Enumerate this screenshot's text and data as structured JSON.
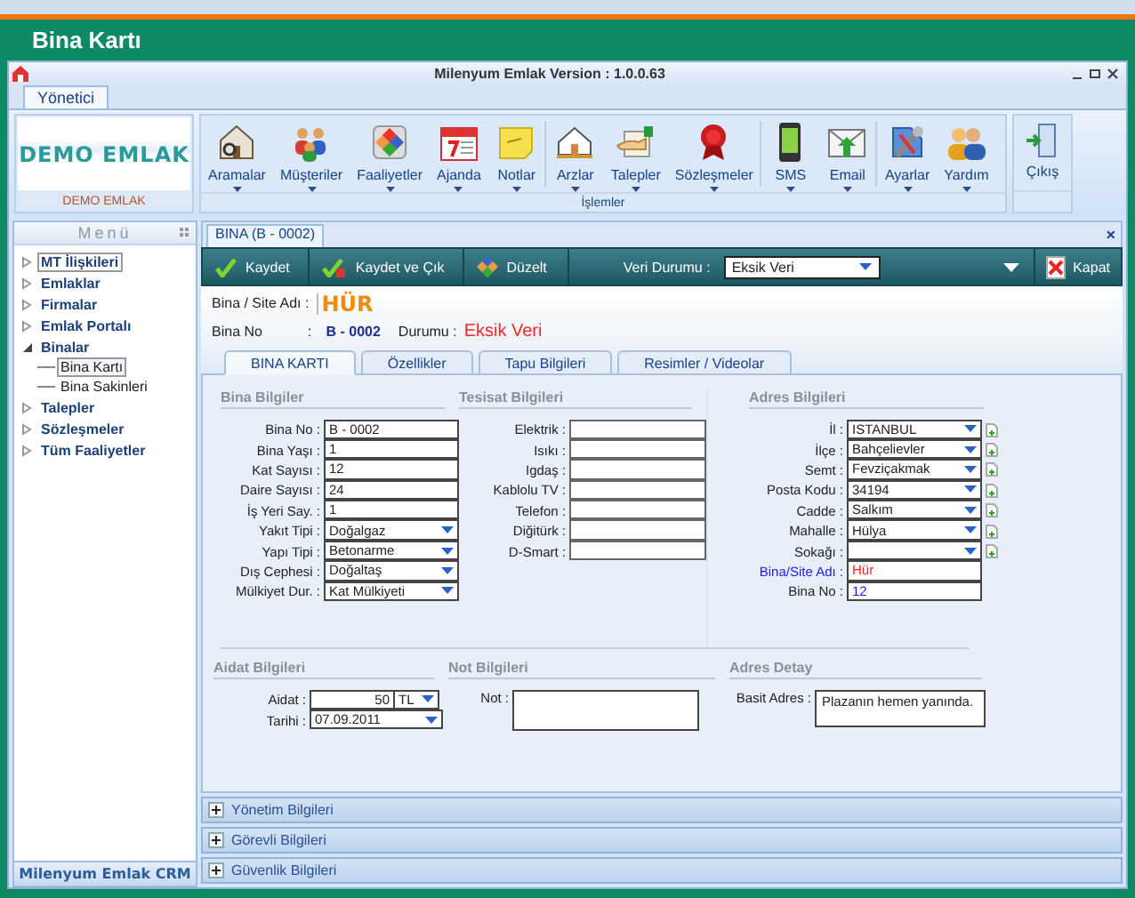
{
  "page_title": "Bina Kartı",
  "window": {
    "title": "Milenyum Emlak Version : 1.0.0.63"
  },
  "ribbon": {
    "tabs": [
      {
        "label": "Yönetici",
        "selected": true
      }
    ],
    "logo": "DEMO EMLAK",
    "logo_caption": "DEMO EMLAK",
    "group_label": "İşlemler",
    "groups": [
      [
        {
          "label": "Aramalar"
        },
        {
          "label": "Müşteriler"
        },
        {
          "label": "Faaliyetler"
        },
        {
          "label": "Ajanda"
        },
        {
          "label": "Notlar"
        }
      ],
      [
        {
          "label": "Arzlar"
        },
        {
          "label": "Talepler"
        },
        {
          "label": "Sözleşmeler"
        }
      ],
      [
        {
          "label": "SMS"
        },
        {
          "label": "Email"
        }
      ],
      [
        {
          "label": "Ayarlar"
        },
        {
          "label": "Yardım"
        }
      ]
    ],
    "exit": {
      "label": "Çıkış"
    }
  },
  "menu": {
    "title": "Menü",
    "footer": "Milenyum Emlak CRM",
    "items": [
      {
        "label": "MT İlişkileri",
        "expanded": false,
        "focused": true
      },
      {
        "label": "Emlaklar",
        "expanded": false,
        "focused": false
      },
      {
        "label": "Firmalar",
        "expanded": false,
        "focused": false
      },
      {
        "label": "Emlak Portalı",
        "expanded": false,
        "focused": false
      },
      {
        "label": "Binalar",
        "expanded": true,
        "focused": false,
        "children": [
          {
            "label": "Bina Kartı",
            "selected": true
          },
          {
            "label": "Bina Sakinleri",
            "selected": false
          }
        ]
      },
      {
        "label": "Talepler",
        "expanded": false,
        "focused": false
      },
      {
        "label": "Sözleşmeler",
        "expanded": false,
        "focused": false
      },
      {
        "label": "Tüm Faaliyetler",
        "expanded": false,
        "focused": false
      }
    ]
  },
  "document_tab": {
    "label": "BINA (B - 0002)",
    "close": "×"
  },
  "toolbar": {
    "buttons": [
      {
        "label": "Kaydet"
      },
      {
        "label": "Kaydet ve Çık"
      },
      {
        "label": "Düzelt"
      }
    ],
    "status_label": "Veri Durumu :",
    "status_value": "Eksik Veri",
    "close_label": "Kapat"
  },
  "header": {
    "site_label": "Bina / Site Adı :",
    "site_value": "HÜR",
    "no_label": "Bina No",
    "no_colon": ":",
    "no_value": "B - 0002",
    "status_label": "Durumu :",
    "status_value": "Eksik Veri"
  },
  "tabs": [
    {
      "label": "BINA KARTI",
      "selected": true
    },
    {
      "label": "Özellikler",
      "selected": false
    },
    {
      "label": "Tapu Bilgileri",
      "selected": false
    },
    {
      "label": "Resimler / Videolar",
      "selected": false
    }
  ],
  "sections": [
    {
      "title": "Bina Bilgiler",
      "fields": [
        {
          "label": "Bina No :",
          "kind": "text",
          "value": "B - 0002"
        },
        {
          "label": "Bina Yaşı :",
          "kind": "text",
          "value": "1"
        },
        {
          "label": "Kat Sayısı :",
          "kind": "text",
          "value": "12"
        },
        {
          "label": "Daire Sayısı :",
          "kind": "text",
          "value": "24"
        },
        {
          "label": "İş Yeri Say. :",
          "kind": "text",
          "value": "1"
        },
        {
          "label": "Yakıt Tipi :",
          "kind": "select",
          "value": "Doğalgaz"
        },
        {
          "label": "Yapı Tipi :",
          "kind": "select",
          "value": "Betonarme"
        },
        {
          "label": "Dış Cephesi :",
          "kind": "select",
          "value": "Doğaltaş"
        },
        {
          "label": "Mülkiyet Dur. :",
          "kind": "select",
          "value": "Kat Mülkiyeti"
        }
      ]
    },
    {
      "title": "Tesisat Bilgileri",
      "fields": [
        {
          "label": "Elektrik :",
          "kind": "text"
        },
        {
          "label": "Isıkı :",
          "kind": "text"
        },
        {
          "label": "Igdaş :",
          "kind": "text"
        },
        {
          "label": "Kablolu TV :",
          "kind": "text"
        },
        {
          "label": "Telefon :",
          "kind": "text"
        },
        {
          "label": "Diğitürk :",
          "kind": "text"
        },
        {
          "label": "D-Smart :",
          "kind": "text"
        }
      ]
    },
    {
      "title": "Adres Bilgileri",
      "fields": [
        {
          "label": "İl :",
          "kind": "select",
          "value": "ISTANBUL"
        },
        {
          "label": "İlçe :",
          "kind": "select",
          "value": "Bahçelievler"
        },
        {
          "label": "Semt :",
          "kind": "select",
          "value": "Fevziçakmak"
        },
        {
          "label": "Posta Kodu :",
          "kind": "select",
          "value": "34194"
        },
        {
          "label": "Cadde :",
          "kind": "select",
          "value": "Salkım"
        },
        {
          "label": "Mahalle :",
          "kind": "select",
          "value": "Hülya"
        },
        {
          "label": "Sokağı :",
          "kind": "select"
        },
        {
          "label": "Bina/Site Adı :",
          "kind": "text",
          "value": "Hür",
          "label_style": {
            "color": "#1a1aff"
          },
          "value_style": {
            "color": "#ff2020"
          }
        },
        {
          "label": "Bina No :",
          "kind": "text",
          "value": "12",
          "value_style": {
            "color": "#1a1aff"
          }
        }
      ]
    }
  ],
  "bottom_sections": [
    {
      "title": "Aidat Bilgileri",
      "kind": "aidat",
      "fields": [
        {
          "label": "Aidat :",
          "value": "50",
          "unit": "TL"
        },
        {
          "label": "Tarihi :",
          "value": "07.09.2011"
        }
      ]
    },
    {
      "title": "Not Bilgileri",
      "kind": "memo",
      "fields": [
        {
          "label": "Not :"
        }
      ]
    },
    {
      "title": "Adres Detay",
      "kind": "memo",
      "fields": [
        {
          "label": "Basit Adres :",
          "value": "Plazanın hemen yanında."
        }
      ]
    }
  ],
  "panels": [
    {
      "label": "Yönetim Bilgileri",
      "expanded": false
    },
    {
      "label": "Görevli Bilgileri",
      "expanded": false
    },
    {
      "label": "Güvenlik Bilgileri",
      "expanded": false
    }
  ]
}
